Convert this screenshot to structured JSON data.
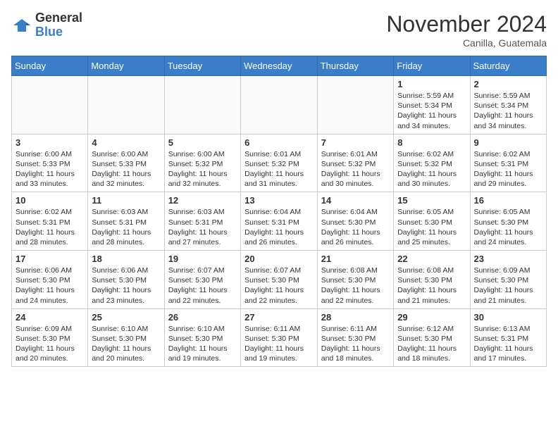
{
  "header": {
    "logo_general": "General",
    "logo_blue": "Blue",
    "month_title": "November 2024",
    "location": "Canilla, Guatemala"
  },
  "calendar": {
    "days_of_week": [
      "Sunday",
      "Monday",
      "Tuesday",
      "Wednesday",
      "Thursday",
      "Friday",
      "Saturday"
    ],
    "weeks": [
      [
        {
          "day": "",
          "sunrise": "",
          "sunset": "",
          "daylight": ""
        },
        {
          "day": "",
          "sunrise": "",
          "sunset": "",
          "daylight": ""
        },
        {
          "day": "",
          "sunrise": "",
          "sunset": "",
          "daylight": ""
        },
        {
          "day": "",
          "sunrise": "",
          "sunset": "",
          "daylight": ""
        },
        {
          "day": "",
          "sunrise": "",
          "sunset": "",
          "daylight": ""
        },
        {
          "day": "1",
          "sunrise": "Sunrise: 5:59 AM",
          "sunset": "Sunset: 5:34 PM",
          "daylight": "Daylight: 11 hours and 34 minutes."
        },
        {
          "day": "2",
          "sunrise": "Sunrise: 5:59 AM",
          "sunset": "Sunset: 5:34 PM",
          "daylight": "Daylight: 11 hours and 34 minutes."
        }
      ],
      [
        {
          "day": "3",
          "sunrise": "Sunrise: 6:00 AM",
          "sunset": "Sunset: 5:33 PM",
          "daylight": "Daylight: 11 hours and 33 minutes."
        },
        {
          "day": "4",
          "sunrise": "Sunrise: 6:00 AM",
          "sunset": "Sunset: 5:33 PM",
          "daylight": "Daylight: 11 hours and 32 minutes."
        },
        {
          "day": "5",
          "sunrise": "Sunrise: 6:00 AM",
          "sunset": "Sunset: 5:32 PM",
          "daylight": "Daylight: 11 hours and 32 minutes."
        },
        {
          "day": "6",
          "sunrise": "Sunrise: 6:01 AM",
          "sunset": "Sunset: 5:32 PM",
          "daylight": "Daylight: 11 hours and 31 minutes."
        },
        {
          "day": "7",
          "sunrise": "Sunrise: 6:01 AM",
          "sunset": "Sunset: 5:32 PM",
          "daylight": "Daylight: 11 hours and 30 minutes."
        },
        {
          "day": "8",
          "sunrise": "Sunrise: 6:02 AM",
          "sunset": "Sunset: 5:32 PM",
          "daylight": "Daylight: 11 hours and 30 minutes."
        },
        {
          "day": "9",
          "sunrise": "Sunrise: 6:02 AM",
          "sunset": "Sunset: 5:31 PM",
          "daylight": "Daylight: 11 hours and 29 minutes."
        }
      ],
      [
        {
          "day": "10",
          "sunrise": "Sunrise: 6:02 AM",
          "sunset": "Sunset: 5:31 PM",
          "daylight": "Daylight: 11 hours and 28 minutes."
        },
        {
          "day": "11",
          "sunrise": "Sunrise: 6:03 AM",
          "sunset": "Sunset: 5:31 PM",
          "daylight": "Daylight: 11 hours and 28 minutes."
        },
        {
          "day": "12",
          "sunrise": "Sunrise: 6:03 AM",
          "sunset": "Sunset: 5:31 PM",
          "daylight": "Daylight: 11 hours and 27 minutes."
        },
        {
          "day": "13",
          "sunrise": "Sunrise: 6:04 AM",
          "sunset": "Sunset: 5:31 PM",
          "daylight": "Daylight: 11 hours and 26 minutes."
        },
        {
          "day": "14",
          "sunrise": "Sunrise: 6:04 AM",
          "sunset": "Sunset: 5:30 PM",
          "daylight": "Daylight: 11 hours and 26 minutes."
        },
        {
          "day": "15",
          "sunrise": "Sunrise: 6:05 AM",
          "sunset": "Sunset: 5:30 PM",
          "daylight": "Daylight: 11 hours and 25 minutes."
        },
        {
          "day": "16",
          "sunrise": "Sunrise: 6:05 AM",
          "sunset": "Sunset: 5:30 PM",
          "daylight": "Daylight: 11 hours and 24 minutes."
        }
      ],
      [
        {
          "day": "17",
          "sunrise": "Sunrise: 6:06 AM",
          "sunset": "Sunset: 5:30 PM",
          "daylight": "Daylight: 11 hours and 24 minutes."
        },
        {
          "day": "18",
          "sunrise": "Sunrise: 6:06 AM",
          "sunset": "Sunset: 5:30 PM",
          "daylight": "Daylight: 11 hours and 23 minutes."
        },
        {
          "day": "19",
          "sunrise": "Sunrise: 6:07 AM",
          "sunset": "Sunset: 5:30 PM",
          "daylight": "Daylight: 11 hours and 22 minutes."
        },
        {
          "day": "20",
          "sunrise": "Sunrise: 6:07 AM",
          "sunset": "Sunset: 5:30 PM",
          "daylight": "Daylight: 11 hours and 22 minutes."
        },
        {
          "day": "21",
          "sunrise": "Sunrise: 6:08 AM",
          "sunset": "Sunset: 5:30 PM",
          "daylight": "Daylight: 11 hours and 22 minutes."
        },
        {
          "day": "22",
          "sunrise": "Sunrise: 6:08 AM",
          "sunset": "Sunset: 5:30 PM",
          "daylight": "Daylight: 11 hours and 21 minutes."
        },
        {
          "day": "23",
          "sunrise": "Sunrise: 6:09 AM",
          "sunset": "Sunset: 5:30 PM",
          "daylight": "Daylight: 11 hours and 21 minutes."
        }
      ],
      [
        {
          "day": "24",
          "sunrise": "Sunrise: 6:09 AM",
          "sunset": "Sunset: 5:30 PM",
          "daylight": "Daylight: 11 hours and 20 minutes."
        },
        {
          "day": "25",
          "sunrise": "Sunrise: 6:10 AM",
          "sunset": "Sunset: 5:30 PM",
          "daylight": "Daylight: 11 hours and 20 minutes."
        },
        {
          "day": "26",
          "sunrise": "Sunrise: 6:10 AM",
          "sunset": "Sunset: 5:30 PM",
          "daylight": "Daylight: 11 hours and 19 minutes."
        },
        {
          "day": "27",
          "sunrise": "Sunrise: 6:11 AM",
          "sunset": "Sunset: 5:30 PM",
          "daylight": "Daylight: 11 hours and 19 minutes."
        },
        {
          "day": "28",
          "sunrise": "Sunrise: 6:11 AM",
          "sunset": "Sunset: 5:30 PM",
          "daylight": "Daylight: 11 hours and 18 minutes."
        },
        {
          "day": "29",
          "sunrise": "Sunrise: 6:12 AM",
          "sunset": "Sunset: 5:30 PM",
          "daylight": "Daylight: 11 hours and 18 minutes."
        },
        {
          "day": "30",
          "sunrise": "Sunrise: 6:13 AM",
          "sunset": "Sunset: 5:31 PM",
          "daylight": "Daylight: 11 hours and 17 minutes."
        }
      ]
    ]
  }
}
